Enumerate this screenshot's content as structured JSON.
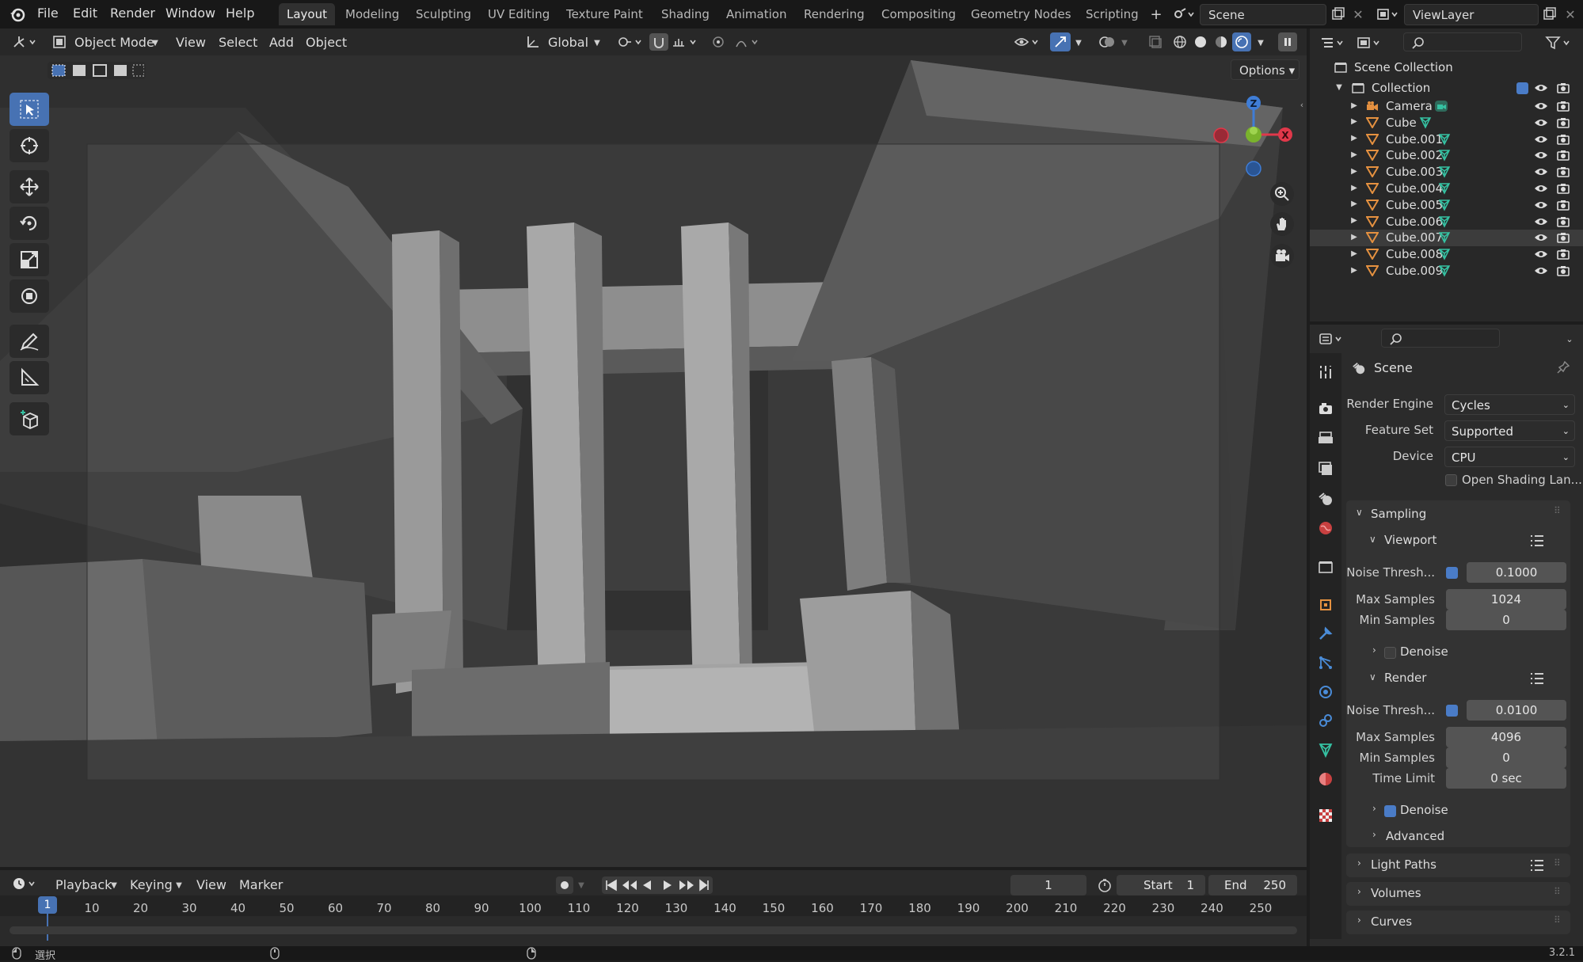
{
  "topbar": {
    "menus": [
      "File",
      "Edit",
      "Render",
      "Window",
      "Help"
    ],
    "workspaces": [
      "Layout",
      "Modeling",
      "Sculpting",
      "UV Editing",
      "Texture Paint",
      "Shading",
      "Animation",
      "Rendering",
      "Compositing",
      "Geometry Nodes",
      "Scripting"
    ],
    "active_workspace": "Layout",
    "scene_name": "Scene",
    "view_layer": "ViewLayer"
  },
  "viewport_header": {
    "mode": "Object Mode",
    "menus": [
      "View",
      "Select",
      "Add",
      "Object"
    ],
    "transform_orientation": "Global",
    "options_label": "Options"
  },
  "gizmo": {
    "z": "Z",
    "x": "X"
  },
  "outliner": {
    "root": "Scene Collection",
    "collection": "Collection",
    "items": [
      {
        "name": "Camera",
        "type": "camera"
      },
      {
        "name": "Cube",
        "type": "mesh"
      },
      {
        "name": "Cube.001",
        "type": "mesh"
      },
      {
        "name": "Cube.002",
        "type": "mesh"
      },
      {
        "name": "Cube.003",
        "type": "mesh"
      },
      {
        "name": "Cube.004",
        "type": "mesh"
      },
      {
        "name": "Cube.005",
        "type": "mesh"
      },
      {
        "name": "Cube.006",
        "type": "mesh"
      },
      {
        "name": "Cube.007",
        "type": "mesh"
      },
      {
        "name": "Cube.008",
        "type": "mesh"
      },
      {
        "name": "Cube.009",
        "type": "mesh"
      }
    ]
  },
  "properties": {
    "context": "Scene",
    "render_engine_label": "Render Engine",
    "render_engine": "Cycles",
    "feature_set_label": "Feature Set",
    "feature_set": "Supported",
    "device_label": "Device",
    "device": "CPU",
    "osl_label": "Open Shading Lan...",
    "sampling": {
      "title": "Sampling",
      "viewport": {
        "title": "Viewport",
        "noise_label": "Noise Thresh...",
        "noise_value": "0.1000",
        "max_label": "Max Samples",
        "max_value": "1024",
        "min_label": "Min Samples",
        "min_value": "0",
        "denoise_label": "Denoise"
      },
      "render": {
        "title": "Render",
        "noise_label": "Noise Thresh...",
        "noise_value": "0.0100",
        "max_label": "Max Samples",
        "max_value": "4096",
        "min_label": "Min Samples",
        "min_value": "0",
        "time_label": "Time Limit",
        "time_value": "0 sec",
        "denoise_label": "Denoise",
        "advanced_label": "Advanced"
      }
    },
    "light_paths": "Light Paths",
    "volumes": "Volumes",
    "curves": "Curves"
  },
  "timeline": {
    "menus": [
      "Playback",
      "Keying",
      "View",
      "Marker"
    ],
    "current_frame": "1",
    "start_label": "Start",
    "start_value": "1",
    "end_label": "End",
    "end_value": "250",
    "ruler": [
      "10",
      "20",
      "30",
      "40",
      "50",
      "60",
      "70",
      "80",
      "90",
      "100",
      "110",
      "120",
      "130",
      "140",
      "150",
      "160",
      "170",
      "180",
      "190",
      "200",
      "210",
      "220",
      "230",
      "240",
      "250"
    ],
    "ruler_current": "1"
  },
  "statusbar": {
    "left_text": "選択",
    "version": "3.2.1"
  },
  "colors": {
    "accent": "#4772b3",
    "axis_x": "#e0384a",
    "axis_y": "#7ab32c",
    "axis_z": "#3f7dd6",
    "mesh_icon": "#35c1a2",
    "object_icon": "#e59140"
  }
}
